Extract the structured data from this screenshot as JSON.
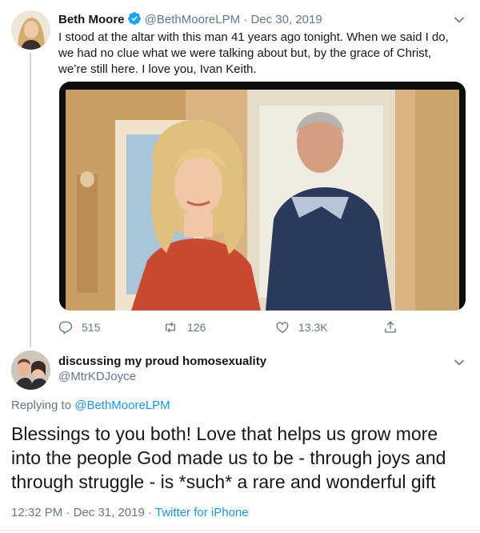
{
  "tweet": {
    "author_name": "Beth Moore",
    "author_handle": "@BethMooreLPM",
    "separator": "·",
    "date": "Dec 30, 2019",
    "text": "I stood at the altar with this man 41 years ago tonight. When we said I do, we had no clue what we were talking about but, by the grace of Christ, we’re still here. I love you, Ivan Keith.",
    "stats": {
      "replies": "515",
      "retweets": "126",
      "likes": "13.3K"
    }
  },
  "reply": {
    "author_name": "discussing my proud homosexuality",
    "author_handle": "@MtrKDJoyce",
    "replying_prefix": "Replying to",
    "replying_to": "@BethMooreLPM",
    "text": "Blessings to you both! Love that helps us grow more into the people God made us to be - through joys and through struggle - is *such* a rare and wonderful gift",
    "time": "12:32 PM",
    "separator": "·",
    "date": "Dec 31, 2019",
    "separator2": "·",
    "source": "Twitter for iPhone"
  },
  "icons": [
    "verified-icon",
    "chevron-down-icon",
    "reply-icon",
    "retweet-icon",
    "like-icon",
    "share-icon"
  ],
  "colors": {
    "text": "#14171a",
    "secondary": "#657786",
    "link": "#1b95e0",
    "verified": "#1da1f2",
    "thread_line": "#ccd6dd"
  }
}
